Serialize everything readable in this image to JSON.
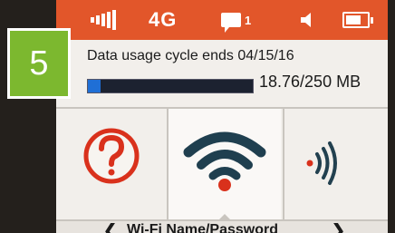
{
  "step_badge": "5",
  "statusbar": {
    "network_label": "4G",
    "message_count": "1",
    "icons": [
      "signal-bars-icon",
      "message-icon",
      "speaker-icon",
      "battery-icon"
    ]
  },
  "usage": {
    "cycle_text": "Data usage cycle ends 04/15/16",
    "amount_text": "18.76/250 MB",
    "fraction": 0.075
  },
  "tiles": [
    "help-question-icon",
    "wifi-icon",
    "share-signal-icon"
  ],
  "nav": {
    "left_chevron": "❮",
    "label": "Wi-Fi Name/Password",
    "right_chevron": "❯"
  },
  "colors": {
    "statusbar": "#e2562a",
    "accent_red": "#d9311c",
    "badge_green": "#7cb82f",
    "usage_blue": "#1f6fd6"
  }
}
